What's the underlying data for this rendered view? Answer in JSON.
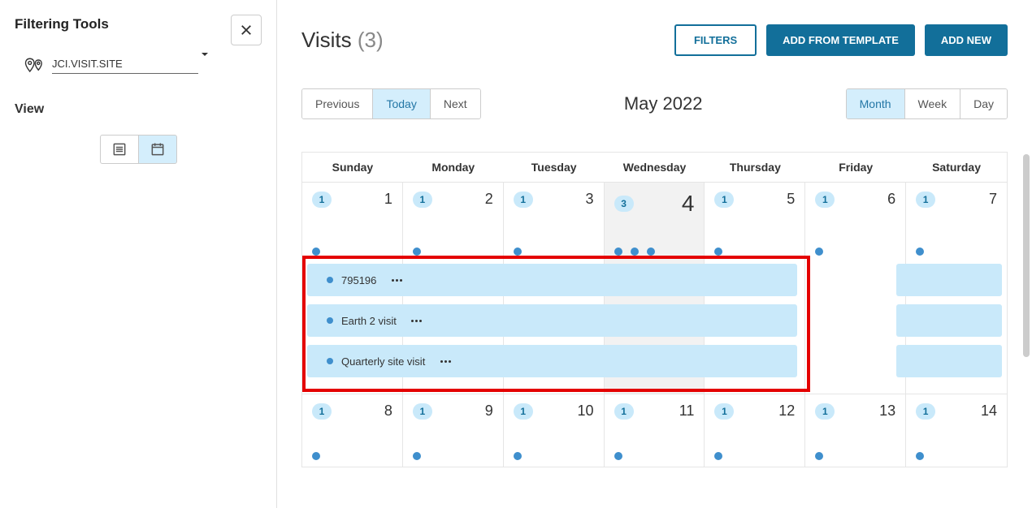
{
  "sidebar": {
    "title": "Filtering Tools",
    "site_label": "JCI.VISIT.SITE",
    "view_label": "View"
  },
  "header": {
    "title": "Visits",
    "count": "(3)",
    "filters_btn": "FILTERS",
    "add_template_btn": "ADD FROM TEMPLATE",
    "add_new_btn": "ADD NEW"
  },
  "nav": {
    "previous": "Previous",
    "today": "Today",
    "next": "Next",
    "month_label": "May 2022",
    "view_month": "Month",
    "view_week": "Week",
    "view_day": "Day"
  },
  "dow": [
    "Sunday",
    "Monday",
    "Tuesday",
    "Wednesday",
    "Thursday",
    "Friday",
    "Saturday"
  ],
  "week1": [
    {
      "badge": "1",
      "num": "1",
      "dots": 1
    },
    {
      "badge": "1",
      "num": "2",
      "dots": 1
    },
    {
      "badge": "1",
      "num": "3",
      "dots": 1
    },
    {
      "badge": "3",
      "num": "4",
      "dots": 3,
      "today": true
    },
    {
      "badge": "1",
      "num": "5",
      "dots": 1
    },
    {
      "badge": "1",
      "num": "6",
      "dots": 1
    },
    {
      "badge": "1",
      "num": "7",
      "dots": 1
    }
  ],
  "week2": [
    {
      "badge": "1",
      "num": "8",
      "dots": 1
    },
    {
      "badge": "1",
      "num": "9",
      "dots": 1
    },
    {
      "badge": "1",
      "num": "10",
      "dots": 1
    },
    {
      "badge": "1",
      "num": "11",
      "dots": 1
    },
    {
      "badge": "1",
      "num": "12",
      "dots": 1
    },
    {
      "badge": "1",
      "num": "13",
      "dots": 1
    },
    {
      "badge": "1",
      "num": "14",
      "dots": 1
    }
  ],
  "events": [
    {
      "label": "795196"
    },
    {
      "label": "Earth 2 visit"
    },
    {
      "label": "Quarterly site visit"
    }
  ]
}
